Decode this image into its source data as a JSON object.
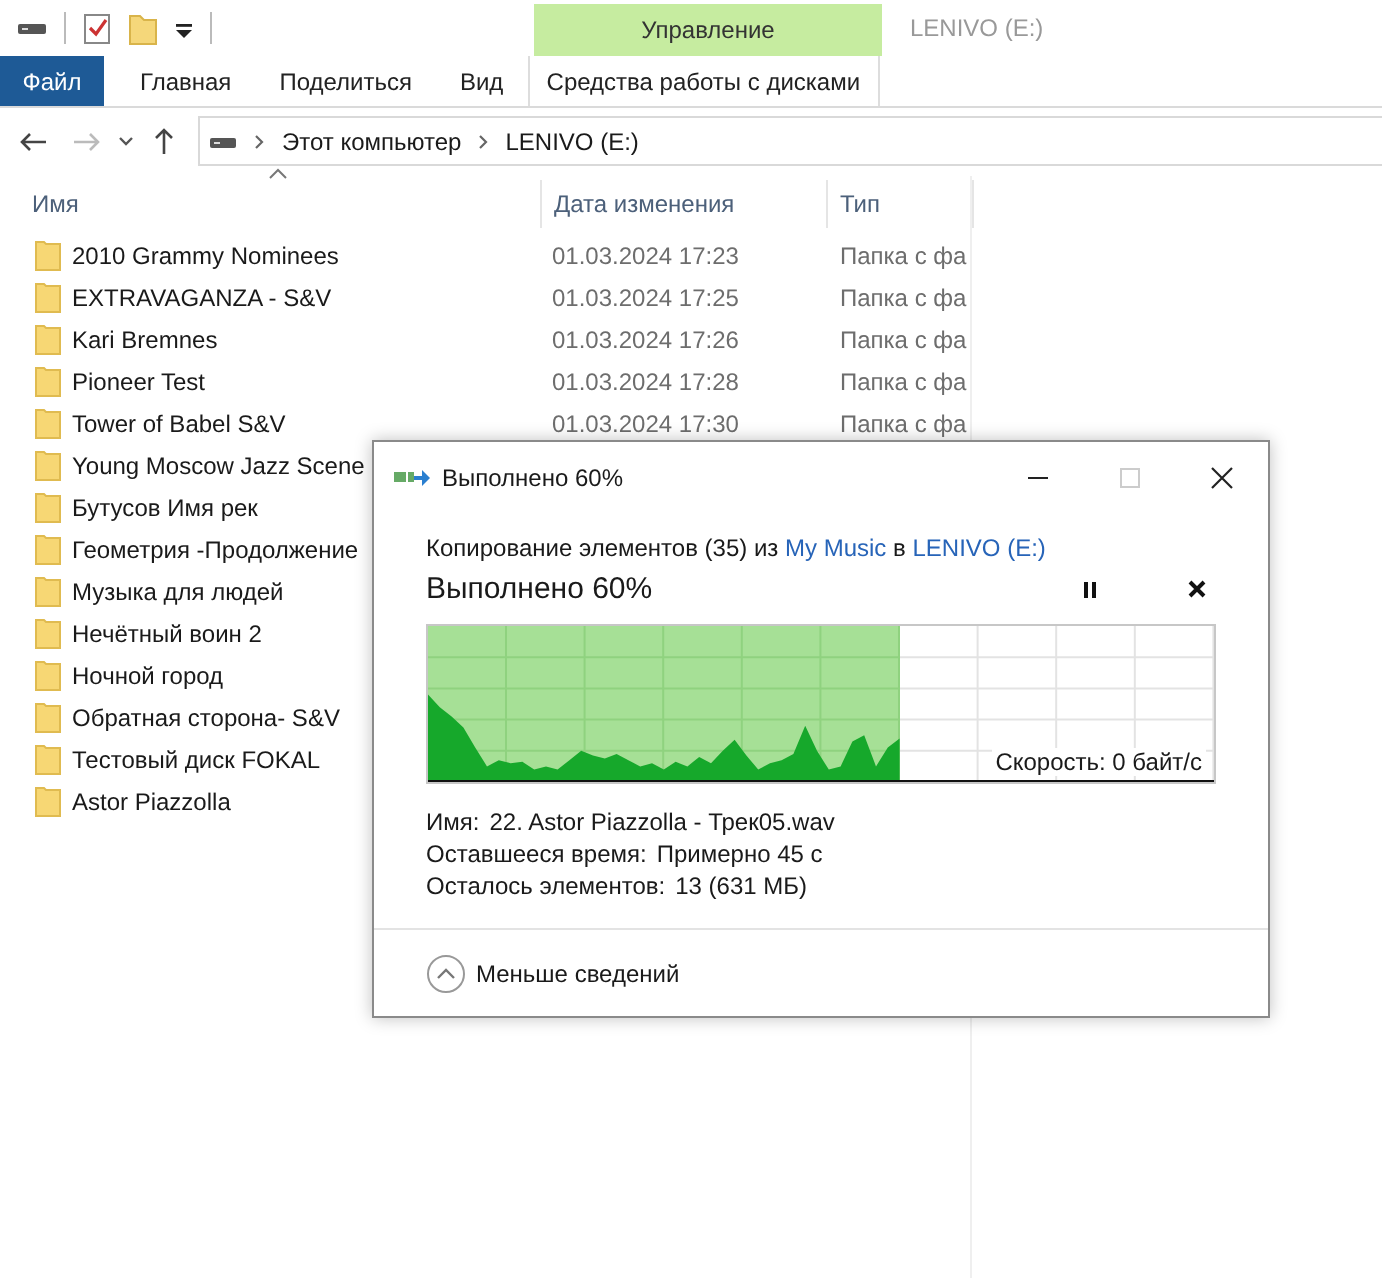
{
  "ribbon": {
    "context_group": "Управление",
    "window_title": "LENIVO (E:)",
    "tabs": [
      {
        "label": "Файл",
        "kind": "file"
      },
      {
        "label": "Главная",
        "kind": "normal"
      },
      {
        "label": "Поделиться",
        "kind": "normal"
      },
      {
        "label": "Вид",
        "kind": "normal"
      },
      {
        "label": "Средства работы с дисками",
        "kind": "context"
      }
    ]
  },
  "address": {
    "path": [
      "Этот компьютер",
      "LENIVO (E:)"
    ]
  },
  "columns": [
    {
      "label": "Имя",
      "sorted": true
    },
    {
      "label": "Дата изменения",
      "sorted": false
    },
    {
      "label": "Тип",
      "sorted": false
    }
  ],
  "files": [
    {
      "name": "2010 Grammy Nominees",
      "date": "01.03.2024 17:23",
      "type": "Папка с фа"
    },
    {
      "name": "EXTRAVAGANZA - S&V",
      "date": "01.03.2024 17:25",
      "type": "Папка с фа"
    },
    {
      "name": "Kari Bremnes",
      "date": "01.03.2024 17:26",
      "type": "Папка с фа"
    },
    {
      "name": "Pioneer Test",
      "date": "01.03.2024 17:28",
      "type": "Папка с фа"
    },
    {
      "name": "Tower of Babel S&V",
      "date": "01.03.2024 17:30",
      "type": "Папка с фа"
    },
    {
      "name": "Young Moscow Jazz Scene"
    },
    {
      "name": "Бутусов Имя рек"
    },
    {
      "name": "Геометрия -Продолжение"
    },
    {
      "name": "Музыка для людей"
    },
    {
      "name": "Нечётный воин 2"
    },
    {
      "name": "Ночной город"
    },
    {
      "name": "Обратная сторона- S&V"
    },
    {
      "name": "Тестовый диск FOKAL"
    },
    {
      "name": "Astor Piazzolla"
    }
  ],
  "dialog": {
    "title": "Выполнено 60%",
    "window_buttons": [
      {
        "kind": "minimize",
        "disabled": false
      },
      {
        "kind": "maximize",
        "disabled": true
      },
      {
        "kind": "close",
        "disabled": false
      }
    ],
    "summary": [
      {
        "text": "Копирование элементов (35) из ",
        "kind": "text"
      },
      {
        "text": "My Music",
        "kind": "link"
      },
      {
        "text": " в ",
        "kind": "text"
      },
      {
        "text": "LENIVO (E:)",
        "kind": "link"
      }
    ],
    "heading": "Выполнено 60%",
    "progress": {
      "level": 0.6,
      "speed": "Скорость: 0 байт/с"
    },
    "details": [
      {
        "label": "Имя:",
        "value": "22. Astor Piazzolla - Трек05.wav"
      },
      {
        "label": "Оставшееся время:",
        "value": "Примерно 45 с"
      },
      {
        "label": "Осталось элементов:",
        "value": "13 (631 МБ)"
      }
    ],
    "toggle": "Меньше сведений"
  }
}
